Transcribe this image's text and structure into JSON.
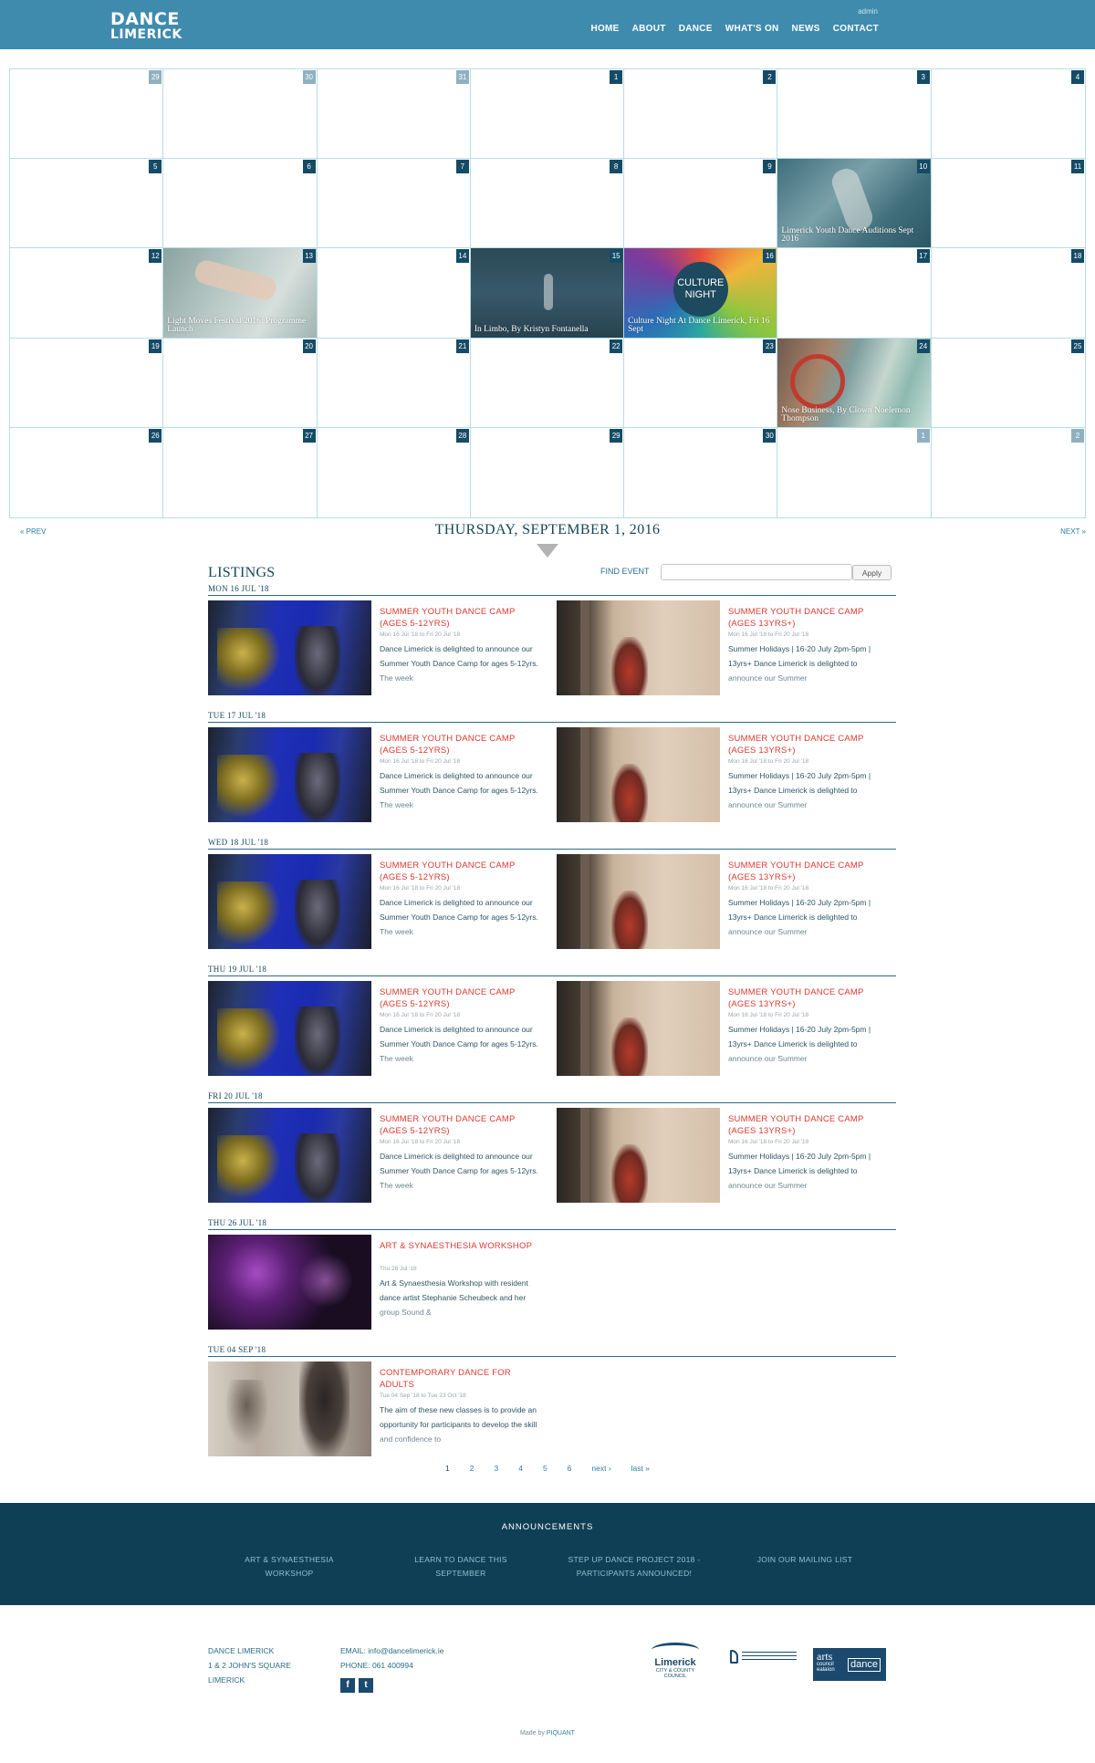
{
  "header": {
    "logo_line1": "DANCE",
    "logo_line2": "LIMERICK",
    "admin": "admin",
    "nav": [
      "HOME",
      "ABOUT",
      "DANCE",
      "WHAT'S ON",
      "NEWS",
      "CONTACT"
    ]
  },
  "calendar": {
    "cells": [
      {
        "day": "29",
        "muted": true
      },
      {
        "day": "30",
        "muted": true
      },
      {
        "day": "31",
        "muted": true
      },
      {
        "day": "1"
      },
      {
        "day": "2"
      },
      {
        "day": "3"
      },
      {
        "day": "4"
      },
      {
        "day": "5"
      },
      {
        "day": "6"
      },
      {
        "day": "7"
      },
      {
        "day": "8"
      },
      {
        "day": "9"
      },
      {
        "day": "10",
        "event": "Limerick Youth Dance Auditions Sept 2016",
        "img": "img-auditions"
      },
      {
        "day": "11"
      },
      {
        "day": "12"
      },
      {
        "day": "13",
        "event": "Light Moves Festival 2016: Programme Launch",
        "img": "img-lightmoves"
      },
      {
        "day": "14"
      },
      {
        "day": "15",
        "event": "In Limbo, By Kristyn Fontanella",
        "img": "img-limbo"
      },
      {
        "day": "16",
        "event": "Culture Night At Dance Limerick, Fri 16 Sept",
        "img": "img-culture",
        "badge": "CULTURE NIGHT"
      },
      {
        "day": "17"
      },
      {
        "day": "18"
      },
      {
        "day": "19"
      },
      {
        "day": "20"
      },
      {
        "day": "21"
      },
      {
        "day": "22"
      },
      {
        "day": "23"
      },
      {
        "day": "24",
        "event": "Nose Business, By Clown Noelemon Thompson",
        "img": "img-nosebusiness"
      },
      {
        "day": "25"
      },
      {
        "day": "26"
      },
      {
        "day": "27"
      },
      {
        "day": "28"
      },
      {
        "day": "29"
      },
      {
        "day": "30"
      },
      {
        "day": "1",
        "muted": true
      },
      {
        "day": "2",
        "muted": true
      }
    ]
  },
  "date_nav": {
    "prev": "« PREV",
    "next": "NEXT »",
    "heading": "THURSDAY, SEPTEMBER 1, 2016"
  },
  "listings": {
    "title": "LISTINGS",
    "find_label": "FIND EVENT",
    "search_value": "",
    "apply": "Apply",
    "days": [
      {
        "label": "MON 16 JUL '18",
        "events": [
          {
            "title": "SUMMER YOUTH DANCE CAMP (AGES 5-12YRS)",
            "date": "Mon 16 Jul '18 to Fri 20 Jul '18",
            "desc": "Dance Limerick is delighted to announce our Summer Youth Dance Camp for ages 5-12yrs. The week",
            "thumb": "th-young"
          },
          {
            "title": "SUMMER YOUTH DANCE CAMP (AGES 13YRS+)",
            "date": "Mon 16 Jul '18 to Fri 20 Jul '18",
            "desc": "Summer Holidays | 16-20 July 2pm-5pm | 13yrs+ Dance Limerick is delighted to announce our Summer",
            "thumb": "th-teen"
          }
        ]
      },
      {
        "label": "TUE 17 JUL '18",
        "events": [
          {
            "title": "SUMMER YOUTH DANCE CAMP (AGES 5-12YRS)",
            "date": "Mon 16 Jul '18 to Fri 20 Jul '18",
            "desc": "Dance Limerick is delighted to announce our Summer Youth Dance Camp for ages 5-12yrs. The week",
            "thumb": "th-young"
          },
          {
            "title": "SUMMER YOUTH DANCE CAMP (AGES 13YRS+)",
            "date": "Mon 16 Jul '18 to Fri 20 Jul '18",
            "desc": "Summer Holidays | 16-20 July 2pm-5pm | 13yrs+ Dance Limerick is delighted to announce our Summer",
            "thumb": "th-teen"
          }
        ]
      },
      {
        "label": "WED 18 JUL '18",
        "events": [
          {
            "title": "SUMMER YOUTH DANCE CAMP (AGES 5-12YRS)",
            "date": "Mon 16 Jul '18 to Fri 20 Jul '18",
            "desc": "Dance Limerick is delighted to announce our Summer Youth Dance Camp for ages 5-12yrs. The week",
            "thumb": "th-young"
          },
          {
            "title": "SUMMER YOUTH DANCE CAMP (AGES 13YRS+)",
            "date": "Mon 16 Jul '18 to Fri 20 Jul '18",
            "desc": "Summer Holidays | 16-20 July 2pm-5pm | 13yrs+ Dance Limerick is delighted to announce our Summer",
            "thumb": "th-teen"
          }
        ]
      },
      {
        "label": "THU 19 JUL '18",
        "events": [
          {
            "title": "SUMMER YOUTH DANCE CAMP (AGES 5-12YRS)",
            "date": "Mon 16 Jul '18 to Fri 20 Jul '18",
            "desc": "Dance Limerick is delighted to announce our Summer Youth Dance Camp for ages 5-12yrs. The week",
            "thumb": "th-young"
          },
          {
            "title": "SUMMER YOUTH DANCE CAMP (AGES 13YRS+)",
            "date": "Mon 16 Jul '18 to Fri 20 Jul '18",
            "desc": "Summer Holidays | 16-20 July 2pm-5pm | 13yrs+ Dance Limerick is delighted to announce our Summer",
            "thumb": "th-teen"
          }
        ]
      },
      {
        "label": "FRI 20 JUL '18",
        "events": [
          {
            "title": "SUMMER YOUTH DANCE CAMP (AGES 5-12YRS)",
            "date": "Mon 16 Jul '18 to Fri 20 Jul '18",
            "desc": "Dance Limerick is delighted to announce our Summer Youth Dance Camp for ages 5-12yrs. The week",
            "thumb": "th-young"
          },
          {
            "title": "SUMMER YOUTH DANCE CAMP (AGES 13YRS+)",
            "date": "Mon 16 Jul '18 to Fri 20 Jul '18",
            "desc": "Summer Holidays | 16-20 July 2pm-5pm | 13yrs+ Dance Limerick is delighted to announce our Summer",
            "thumb": "th-teen"
          }
        ]
      },
      {
        "label": "THU 26 JUL '18",
        "events": [
          {
            "title": "ART & SYNAESTHESIA WORKSHOP",
            "date": "Thu 26 Jul '18",
            "desc": "Art & Synaesthesia Workshop with resident dance artist Stephanie Scheubeck and her group Sound &",
            "thumb": "th-art"
          }
        ]
      },
      {
        "label": "TUE 04 SEP '18",
        "events": [
          {
            "title": "CONTEMPORARY DANCE FOR ADULTS",
            "date": "Tue 04 Sep '18 to Tue 23 Oct '18",
            "desc": "The aim of these new classes is to provide an opportunity for participants to develop the skill and confidence to",
            "thumb": "th-contemp"
          }
        ]
      }
    ]
  },
  "pagination": [
    "1",
    "2",
    "3",
    "4",
    "5",
    "6",
    "next ›",
    "last »"
  ],
  "announcements": {
    "title": "ANNOUNCEMENTS",
    "items": [
      "ART & SYNAESTHESIA WORKSHOP",
      "LEARN TO DANCE THIS SEPTEMBER",
      "STEP UP DANCE PROJECT 2018 - PARTICIPANTS ANNOUNCED!",
      "JOIN OUR MAILING LIST"
    ]
  },
  "footer": {
    "address": [
      "DANCE LIMERICK",
      "1 & 2 JOHN'S SQUARE",
      "LIMERICK"
    ],
    "email": "EMAIL: info@dancelimerick.ie",
    "phone": "PHONE: 061 400994",
    "social": [
      "f",
      "t"
    ],
    "logo_limerick": "Limerick",
    "logo_limerick_sub": "CITY & COUNTY COUNCIL",
    "logo_arts_1": "arts",
    "logo_arts_2": "council",
    "logo_arts_3": "ealaíon",
    "logo_dance": "dance",
    "made_by": "Made by",
    "made_by_link": "PIQUANT"
  },
  "colors": {
    "header_bg": "#3f8bad",
    "accent_red": "#d93a2f",
    "dark_navy": "#0f3f55"
  }
}
